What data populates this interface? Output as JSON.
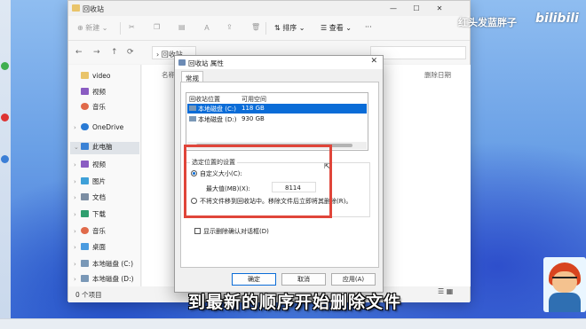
{
  "overlay": {
    "uploader": "红头发蓝胖子",
    "logo": "bilibili",
    "subtitle": "到最新的顺序开始删除文件"
  },
  "explorer": {
    "title": "回收站",
    "window_controls": [
      "—",
      "☐",
      "✕"
    ],
    "toolbar": {
      "new_label": "新建",
      "sort_label": "排序",
      "view_label": "查看"
    },
    "address": "回收站",
    "columns": [
      "名称",
      "删除日期"
    ],
    "sidebar": {
      "items": [
        {
          "label": "video",
          "icon": "folder-icon"
        },
        {
          "label": "视频",
          "icon": "video-icon"
        },
        {
          "label": "音乐",
          "icon": "music-icon"
        },
        {
          "label": "OneDrive",
          "icon": "cloud-icon"
        },
        {
          "label": "此电脑",
          "icon": "pc-icon"
        },
        {
          "label": "视频",
          "icon": "video-icon"
        },
        {
          "label": "图片",
          "icon": "image-icon"
        },
        {
          "label": "文档",
          "icon": "document-icon"
        },
        {
          "label": "下载",
          "icon": "download-icon"
        },
        {
          "label": "音乐",
          "icon": "music-icon"
        },
        {
          "label": "桌面",
          "icon": "desktop-icon"
        },
        {
          "label": "本地磁盘 (C:)",
          "icon": "drive-icon"
        },
        {
          "label": "本地磁盘 (D:)",
          "icon": "drive-icon"
        }
      ]
    },
    "status": "0 个项目"
  },
  "dialog": {
    "title": "回收站 属性",
    "close": "✕",
    "tab": "常规",
    "list": {
      "headers": [
        "回收站位置",
        "可用空间"
      ],
      "rows": [
        {
          "location": "本地磁盘 (C:)",
          "space": "118 GB",
          "selected": true
        },
        {
          "location": "本地磁盘 (D:)",
          "space": "930 GB",
          "selected": false
        }
      ]
    },
    "settings_group": "选定位置的设置",
    "custom_size_label": "自定义大小(C):",
    "max_size_label": "最大值(MB)(X):",
    "max_size_value": "8114",
    "no_move_label": "不将文件移到回收站中。移除文件后立即将其删除(R)。",
    "confirm_label": "显示删除确认对话框(D)",
    "buttons": {
      "ok": "确定",
      "cancel": "取消",
      "apply": "应用(A)"
    }
  },
  "colors": {
    "selection": "#0a6cd7",
    "highlight_box": "#e0453a"
  }
}
